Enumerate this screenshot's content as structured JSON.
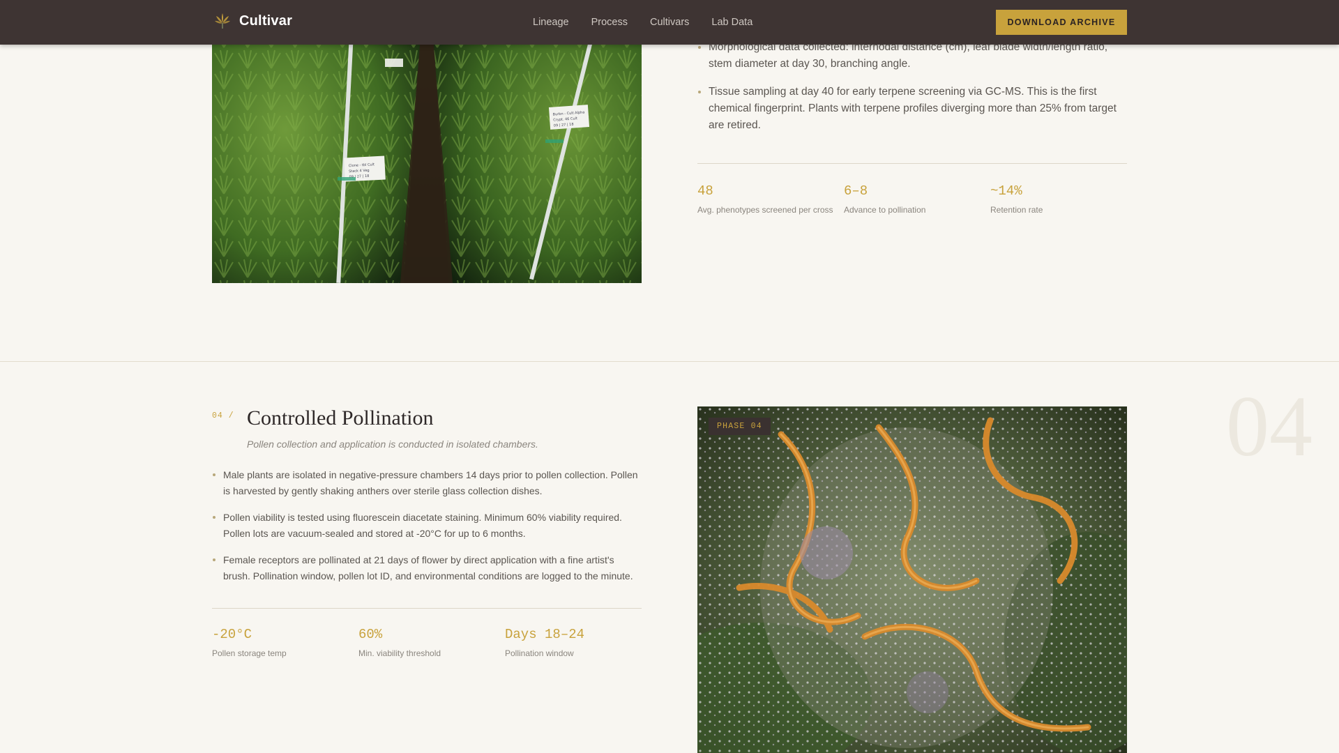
{
  "header": {
    "brand": "Cultivar",
    "nav": [
      "Lineage",
      "Process",
      "Cultivars",
      "Lab Data"
    ],
    "cta": "DOWNLOAD ARCHIVE"
  },
  "upper": {
    "bullets": [
      "Morphological data collected: internodal distance (cm), leaf blade width/length ratio, stem diameter at day 30, branching angle.",
      "Tissue sampling at day 40 for early terpene screening via GC-MS. This is the first chemical fingerprint. Plants with terpene profiles diverging more than 25% from target are retired."
    ],
    "stats": [
      {
        "value": "48",
        "label": "Avg. phenotypes screened per cross"
      },
      {
        "value": "6–8",
        "label": "Advance to pollination"
      },
      {
        "value": "~14%",
        "label": "Retention rate"
      }
    ]
  },
  "phase": {
    "number": "04 /",
    "title": "Controlled Pollination",
    "subtitle": "Pollen collection and application is conducted in isolated chambers.",
    "bullets": [
      "Male plants are isolated in negative-pressure chambers 14 days prior to pollen collection. Pollen is harvested by gently shaking anthers over sterile glass collection dishes.",
      "Pollen viability is tested using fluorescein diacetate staining. Minimum 60% viability required. Pollen lots are vacuum-sealed and stored at -20°C for up to 6 months.",
      "Female receptors are pollinated at 21 days of flower by direct application with a fine artist's brush. Pollination window, pollen lot ID, and environmental conditions are logged to the minute."
    ],
    "stats": [
      {
        "value": "-20°C",
        "label": "Pollen storage temp"
      },
      {
        "value": "60%",
        "label": "Min. viability threshold"
      },
      {
        "value": "Days 18–24",
        "label": "Pollination window"
      }
    ],
    "badge": "PHASE 04",
    "ghost": "04"
  },
  "field_tags": {
    "left": [
      "Clone - tbl Cult",
      "Stack 4 Veg",
      "09 | 27 | 18"
    ],
    "right": [
      "Burbn - Cult Alpha",
      "Crypt. 46 Cult",
      "09 | 27 | 18"
    ]
  }
}
